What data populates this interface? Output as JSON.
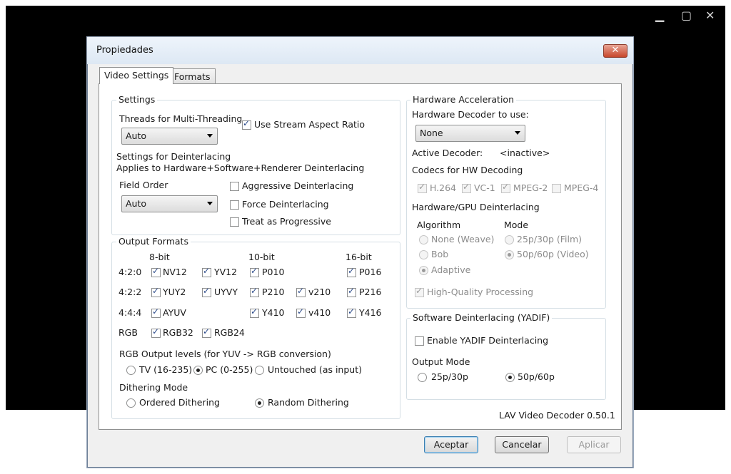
{
  "background_window": {
    "minimize": "▁",
    "maximize": "▢",
    "close": "✕"
  },
  "dialog": {
    "title": "Propiedades",
    "close": "✕"
  },
  "tabs": [
    "Video Settings",
    "Formats"
  ],
  "settings": {
    "group": "Settings",
    "threads_label": "Threads for Multi-Threading",
    "threads_value": "Auto",
    "stream_aspect": "Use Stream Aspect Ratio",
    "deint_title": "Settings for Deinterlacing",
    "deint_sub": "Applies to Hardware+Software+Renderer Deinterlacing",
    "field_order_label": "Field Order",
    "field_order_value": "Auto",
    "aggressive": "Aggressive Deinterlacing",
    "force": "Force Deinterlacing",
    "progressive": "Treat as Progressive"
  },
  "output": {
    "group": "Output Formats",
    "col_8": "8-bit",
    "col_10": "10-bit",
    "col_16": "16-bit",
    "rows": [
      "4:2:0",
      "4:2:2",
      "4:4:4",
      "RGB"
    ],
    "formats": {
      "nv12": "NV12",
      "yv12": "YV12",
      "p010": "P010",
      "p016": "P016",
      "yuy2": "YUY2",
      "uyvy": "UYVY",
      "p210": "P210",
      "v210": "v210",
      "p216": "P216",
      "ayuv": "AYUV",
      "y410": "Y410",
      "v410": "v410",
      "y416": "Y416",
      "rgb32": "RGB32",
      "rgb24": "RGB24"
    },
    "rgb_levels_label": "RGB Output levels (for YUV -> RGB conversion)",
    "tv": "TV (16-235)",
    "pc": "PC (0-255)",
    "untouched": "Untouched (as input)",
    "dither_label": "Dithering Mode",
    "ordered": "Ordered Dithering",
    "random": "Random Dithering"
  },
  "hw": {
    "group": "Hardware Acceleration",
    "decoder_label": "Hardware Decoder to use:",
    "decoder_value": "None",
    "active_label": "Active Decoder:",
    "active_value": "<inactive>",
    "codecs_label": "Codecs for HW Decoding",
    "h264": "H.264",
    "vc1": "VC-1",
    "mpeg2": "MPEG-2",
    "mpeg4": "MPEG-4",
    "gpu_deint_label": "Hardware/GPU Deinterlacing",
    "algorithm_label": "Algorithm",
    "mode_label": "Mode",
    "none_weave": "None (Weave)",
    "bob": "Bob",
    "adaptive": "Adaptive",
    "film": "25p/30p (Film)",
    "video": "50p/60p (Video)",
    "hq": "High-Quality Processing"
  },
  "sw": {
    "group": "Software Deinterlacing (YADIF)",
    "enable": "Enable YADIF Deinterlacing",
    "output_mode_label": "Output Mode",
    "p25": "25p/30p",
    "p50": "50p/60p"
  },
  "version": "LAV Video Decoder 0.50.1",
  "buttons": {
    "ok": "Aceptar",
    "cancel": "Cancelar",
    "apply": "Aplicar"
  }
}
